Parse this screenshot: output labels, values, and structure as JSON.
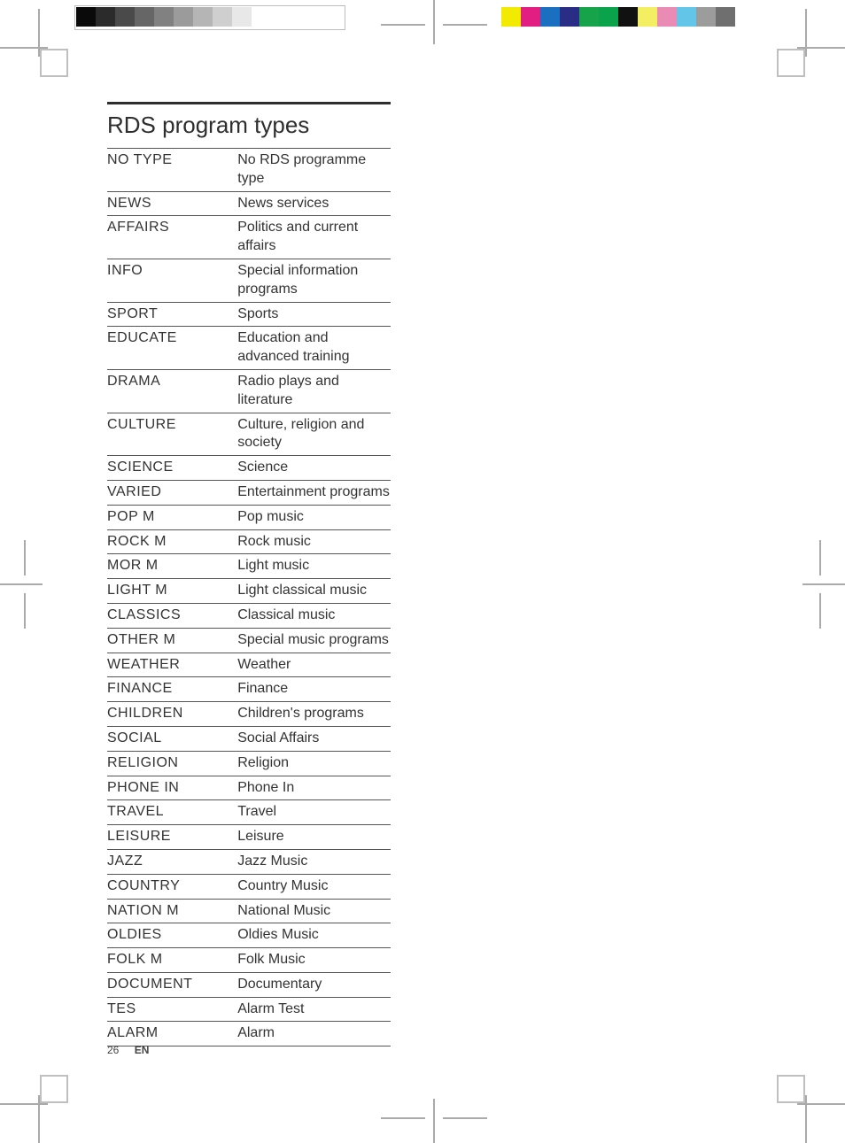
{
  "heading": "RDS program types",
  "page_number": "26",
  "language_code": "EN",
  "rows": [
    {
      "key": "NO TYPE",
      "val": "No RDS programme type"
    },
    {
      "key": "NEWS",
      "val": "News services"
    },
    {
      "key": "AFFAIRS",
      "val": "Politics and current affairs"
    },
    {
      "key": "INFO",
      "val": "Special information programs"
    },
    {
      "key": "SPORT",
      "val": "Sports"
    },
    {
      "key": "EDUCATE",
      "val": "Education and advanced training"
    },
    {
      "key": "DRAMA",
      "val": "Radio plays and literature"
    },
    {
      "key": "CULTURE",
      "val": "Culture, religion and society"
    },
    {
      "key": "SCIENCE",
      "val": "Science"
    },
    {
      "key": "VARIED",
      "val": "Entertainment programs"
    },
    {
      "key": "POP M",
      "val": "Pop music"
    },
    {
      "key": "ROCK M",
      "val": "Rock music"
    },
    {
      "key": "MOR M",
      "val": "Light music"
    },
    {
      "key": "LIGHT M",
      "val": "Light classical music"
    },
    {
      "key": "CLASSICS",
      "val": "Classical music"
    },
    {
      "key": "OTHER M",
      "val": "Special music programs"
    },
    {
      "key": "WEATHER",
      "val": "Weather"
    },
    {
      "key": "FINANCE",
      "val": "Finance"
    },
    {
      "key": "CHILDREN",
      "val": "Children's programs"
    },
    {
      "key": " SOCIAL",
      "val": "Social Affairs"
    },
    {
      "key": "RELIGION",
      "val": "Religion"
    },
    {
      "key": "PHONE IN",
      "val": "Phone In"
    },
    {
      "key": "TRAVEL",
      "val": "Travel"
    },
    {
      "key": "LEISURE",
      "val": "Leisure"
    },
    {
      "key": "JAZZ",
      "val": "Jazz Music"
    },
    {
      "key": "COUNTRY",
      "val": "Country Music"
    },
    {
      "key": "NATION M",
      "val": "National Music"
    },
    {
      "key": "OLDIES",
      "val": "Oldies Music"
    },
    {
      "key": "FOLK M",
      "val": "Folk Music"
    },
    {
      "key": "DOCUMENT",
      "val": "Documentary"
    },
    {
      "key": "TES",
      "val": "Alarm Test"
    },
    {
      "key": "ALARM",
      "val": "Alarm"
    }
  ],
  "colorbars": {
    "left": [
      "#0a0a0a",
      "#2b2b2b",
      "#4a4a4a",
      "#666666",
      "#818181",
      "#9b9b9b",
      "#b5b5b5",
      "#cfcfcf",
      "#e8e8e8",
      "#ffffff"
    ],
    "right": [
      "#f2ea00",
      "#e21e82",
      "#1a6fc0",
      "#2a2d86",
      "#17a34a",
      "#0aa24b",
      "#111111",
      "#f4ef62",
      "#e98bb5",
      "#63c5e7",
      "#9c9c9c",
      "#6f6f6f"
    ]
  }
}
